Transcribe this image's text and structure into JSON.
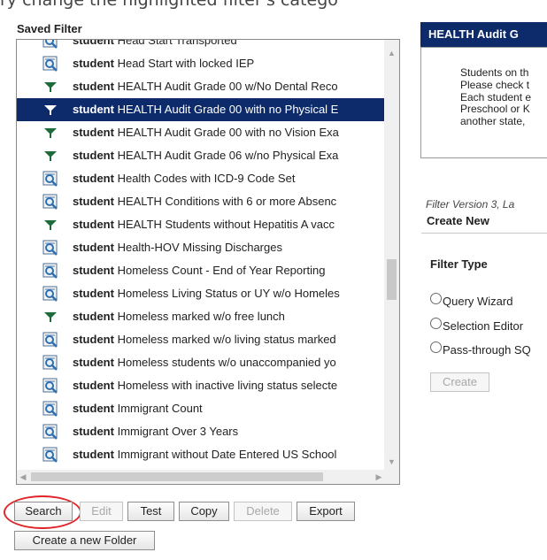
{
  "top_cut_text": "ry change the highlighted filter's catego",
  "saved_filter": {
    "label": "Saved Filter",
    "items": [
      {
        "icon": "query-icon",
        "kw": "student",
        "text": "Head Start Transported",
        "selected": false
      },
      {
        "icon": "query-icon",
        "kw": "student",
        "text": "Head Start with locked IEP",
        "selected": false
      },
      {
        "icon": "filter-icon",
        "kw": "student",
        "text": "HEALTH Audit Grade 00 w/No Dental Reco",
        "selected": false
      },
      {
        "icon": "filter-icon",
        "kw": "student",
        "text": "HEALTH Audit Grade 00 with no Physical E",
        "selected": true
      },
      {
        "icon": "filter-icon",
        "kw": "student",
        "text": "HEALTH Audit Grade 00 with no Vision Exa",
        "selected": false
      },
      {
        "icon": "filter-icon",
        "kw": "student",
        "text": "HEALTH Audit Grade 06 w/no Physical Exa",
        "selected": false
      },
      {
        "icon": "query-icon",
        "kw": "student",
        "text": "Health Codes with ICD-9 Code Set",
        "selected": false
      },
      {
        "icon": "query-icon",
        "kw": "student",
        "text": "HEALTH Conditions with 6 or more Absenc",
        "selected": false
      },
      {
        "icon": "filter-icon",
        "kw": "student",
        "text": "HEALTH Students without Hepatitis A vacc",
        "selected": false
      },
      {
        "icon": "query-icon",
        "kw": "student",
        "text": "Health-HOV Missing Discharges",
        "selected": false
      },
      {
        "icon": "query-icon",
        "kw": "student",
        "text": "Homeless Count - End of Year Reporting",
        "selected": false
      },
      {
        "icon": "query-icon",
        "kw": "student",
        "text": "Homeless Living Status or UY w/o Homeles",
        "selected": false
      },
      {
        "icon": "filter-icon",
        "kw": "student",
        "text": "Homeless marked w/o free lunch",
        "selected": false
      },
      {
        "icon": "query-icon",
        "kw": "student",
        "text": "Homeless marked w/o living status marked",
        "selected": false
      },
      {
        "icon": "query-icon",
        "kw": "student",
        "text": "Homeless students w/o unaccompanied yo",
        "selected": false
      },
      {
        "icon": "query-icon",
        "kw": "student",
        "text": "Homeless with inactive living status selecte",
        "selected": false
      },
      {
        "icon": "query-icon",
        "kw": "student",
        "text": "Immigrant Count",
        "selected": false
      },
      {
        "icon": "query-icon",
        "kw": "student",
        "text": "Immigrant Over 3 Years",
        "selected": false
      },
      {
        "icon": "query-icon",
        "kw": "student",
        "text": "Immigrant without Date Entered US School",
        "selected": false
      }
    ]
  },
  "buttons": {
    "search": "Search",
    "edit": "Edit",
    "test": "Test",
    "copy": "Copy",
    "delete": "Delete",
    "export": "Export",
    "new_folder": "Create a new Folder"
  },
  "detail": {
    "title": "HEALTH Audit G",
    "lines": [
      "Students on th",
      "Please check t",
      "Each student e",
      "Preschool or K",
      "another state,"
    ],
    "version": "Filter Version 3,   La"
  },
  "create_new": {
    "heading": "Create New",
    "filter_type_label": "Filter Type",
    "options": [
      "Query Wizard",
      "Selection Editor",
      "Pass-through SQ"
    ],
    "create_button": "Create"
  },
  "colors": {
    "selected_bg": "#0d2b6b",
    "header_bg": "#0d2b6b",
    "highlight_ring": "#e0262a",
    "filter_icon": "#1e6b3a",
    "query_icon": "#2d6fb0"
  }
}
